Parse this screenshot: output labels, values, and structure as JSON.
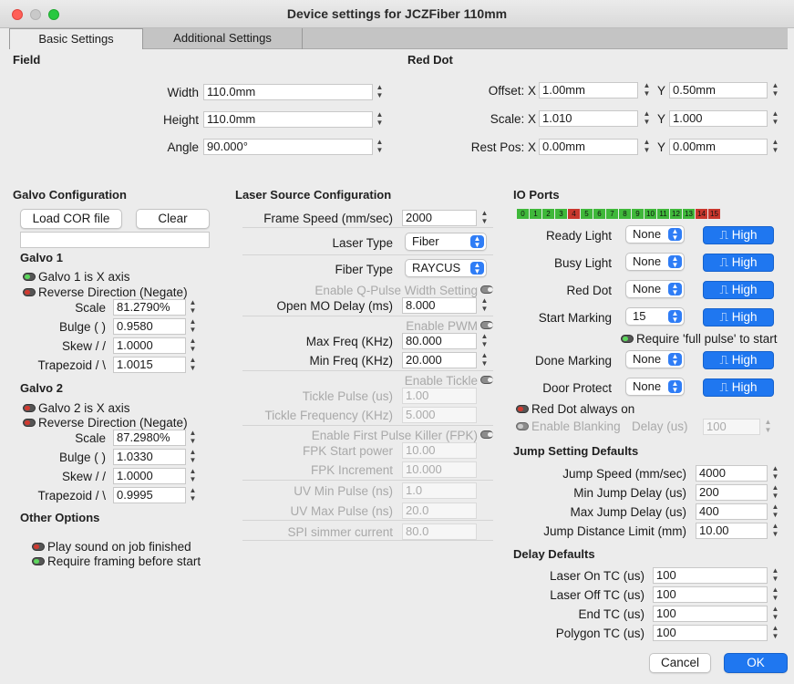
{
  "window": {
    "title": "Device settings for JCZFiber 110mm"
  },
  "tabs": [
    "Basic Settings",
    "Additional Settings"
  ],
  "field": {
    "header": "Field",
    "width_label": "Width",
    "width": "110.0mm",
    "height_label": "Height",
    "height": "110.0mm",
    "angle_label": "Angle",
    "angle": "90.000°"
  },
  "red_dot": {
    "header": "Red Dot",
    "offset_label": "Offset: X",
    "offset_x": "1.00mm",
    "offset_y": "0.50mm",
    "scale_label": "Scale: X",
    "scale_x": "1.010",
    "scale_y": "1.000",
    "rest_label": "Rest Pos: X",
    "rest_x": "0.00mm",
    "rest_y": "0.00mm",
    "y_label": "Y"
  },
  "galvo": {
    "header": "Galvo Configuration",
    "load_cor": "Load COR file",
    "clear": "Clear",
    "g1": {
      "title": "Galvo 1",
      "is_x": "Galvo 1 is X axis",
      "reverse": "Reverse Direction (Negate)",
      "scale_label": "Scale",
      "scale": "81.2790%",
      "bulge_label": "Bulge ( )",
      "bulge": "0.9580",
      "skew_label": "Skew / /",
      "skew": "1.0000",
      "trap_label": "Trapezoid / \\",
      "trap": "1.0015"
    },
    "g2": {
      "title": "Galvo 2",
      "is_x": "Galvo 2 is X axis",
      "reverse": "Reverse Direction (Negate)",
      "scale_label": "Scale",
      "scale": "87.2980%",
      "bulge_label": "Bulge ( )",
      "bulge": "1.0330",
      "skew_label": "Skew / /",
      "skew": "1.0000",
      "trap_label": "Trapezoid / \\",
      "trap": "0.9995"
    }
  },
  "other": {
    "header": "Other Options",
    "sound": "Play sound on job finished",
    "framing": "Require framing before start"
  },
  "laser": {
    "header": "Laser Source Configuration",
    "frame_speed_label": "Frame Speed (mm/sec)",
    "frame_speed": "2000",
    "laser_type_label": "Laser Type",
    "laser_type": "Fiber",
    "fiber_type_label": "Fiber Type",
    "fiber_type": "RAYCUS",
    "qpulse": "Enable Q-Pulse Width Setting",
    "mo_delay_label": "Open MO Delay (ms)",
    "mo_delay": "8.000",
    "pwm": "Enable PWM",
    "max_freq_label": "Max Freq (KHz)",
    "max_freq": "80.000",
    "min_freq_label": "Min Freq (KHz)",
    "min_freq": "20.000",
    "tickle": "Enable Tickle",
    "tickle_pulse_label": "Tickle Pulse (us)",
    "tickle_pulse": "1.00",
    "tickle_freq_label": "Tickle Frequency (KHz)",
    "tickle_freq": "5.000",
    "fpk": "Enable First Pulse Killer (FPK)",
    "fpk_start_label": "FPK Start power",
    "fpk_start": "10.00",
    "fpk_inc_label": "FPK Increment",
    "fpk_inc": "10.000",
    "uv_min_label": "UV Min Pulse (ns)",
    "uv_min": "1.0",
    "uv_max_label": "UV Max Pulse (ns)",
    "uv_max": "20.0",
    "spi_label": "SPI simmer current",
    "spi": "80.0"
  },
  "io": {
    "header": "IO Ports",
    "ports": [
      {
        "n": "0",
        "c": "#3fb83a"
      },
      {
        "n": "1",
        "c": "#3fb83a"
      },
      {
        "n": "2",
        "c": "#3fb83a"
      },
      {
        "n": "3",
        "c": "#3fb83a"
      },
      {
        "n": "4",
        "c": "#c8372d"
      },
      {
        "n": "5",
        "c": "#3fb83a"
      },
      {
        "n": "6",
        "c": "#3fb83a"
      },
      {
        "n": "7",
        "c": "#3fb83a"
      },
      {
        "n": "8",
        "c": "#3fb83a"
      },
      {
        "n": "9",
        "c": "#3fb83a"
      },
      {
        "n": "10",
        "c": "#3fb83a"
      },
      {
        "n": "11",
        "c": "#3fb83a"
      },
      {
        "n": "12",
        "c": "#3fb83a"
      },
      {
        "n": "13",
        "c": "#3fb83a"
      },
      {
        "n": "14",
        "c": "#c8372d"
      },
      {
        "n": "15",
        "c": "#c8372d"
      }
    ],
    "rows": [
      {
        "label": "Ready Light",
        "value": "None",
        "level": "High"
      },
      {
        "label": "Busy Light",
        "value": "None",
        "level": "High"
      },
      {
        "label": "Red Dot",
        "value": "None",
        "level": "High"
      },
      {
        "label": "Start Marking",
        "value": "15",
        "level": "High"
      },
      {
        "label": "Done Marking",
        "value": "None",
        "level": "High"
      },
      {
        "label": "Door Protect",
        "value": "None",
        "level": "High"
      }
    ],
    "full_pulse": "Require 'full pulse' to start",
    "red_dot_on": "Red Dot always on",
    "blanking": "Enable Blanking",
    "delay_label": "Delay (us)",
    "delay": "100"
  },
  "jump": {
    "header": "Jump Setting Defaults",
    "speed_label": "Jump Speed (mm/sec)",
    "speed": "4000",
    "min_label": "Min Jump Delay (us)",
    "min": "200",
    "max_label": "Max Jump Delay (us)",
    "max": "400",
    "dist_label": "Jump Distance Limit (mm)",
    "dist": "10.00"
  },
  "delay": {
    "header": "Delay Defaults",
    "on_label": "Laser On TC (us)",
    "on": "100",
    "off_label": "Laser Off TC (us)",
    "off": "100",
    "end_label": "End TC (us)",
    "end": "100",
    "poly_label": "Polygon TC (us)",
    "poly": "100"
  },
  "buttons": {
    "cancel": "Cancel",
    "ok": "OK"
  }
}
